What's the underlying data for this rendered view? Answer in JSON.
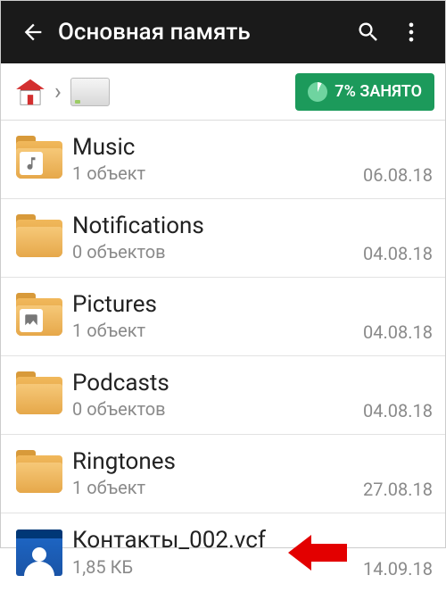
{
  "appbar": {
    "title": "Основная память"
  },
  "storage": {
    "used_label": "7% ЗАНЯТО"
  },
  "items": [
    {
      "name": "Music",
      "sub": "1 объект",
      "date": "06.08.18",
      "kind": "folder",
      "inset": "music"
    },
    {
      "name": "Notifications",
      "sub": "0 объектов",
      "date": "04.08.18",
      "kind": "folder",
      "inset": ""
    },
    {
      "name": "Pictures",
      "sub": "1 объект",
      "date": "04.08.18",
      "kind": "folder",
      "inset": "picture"
    },
    {
      "name": "Podcasts",
      "sub": "0 объектов",
      "date": "04.08.18",
      "kind": "folder",
      "inset": ""
    },
    {
      "name": "Ringtones",
      "sub": "1 объект",
      "date": "27.08.18",
      "kind": "folder",
      "inset": ""
    },
    {
      "name": "Контакты_002.vcf",
      "sub": "1,85 КБ",
      "date": "14.09.18",
      "kind": "contact",
      "inset": "",
      "pointer": true
    }
  ]
}
